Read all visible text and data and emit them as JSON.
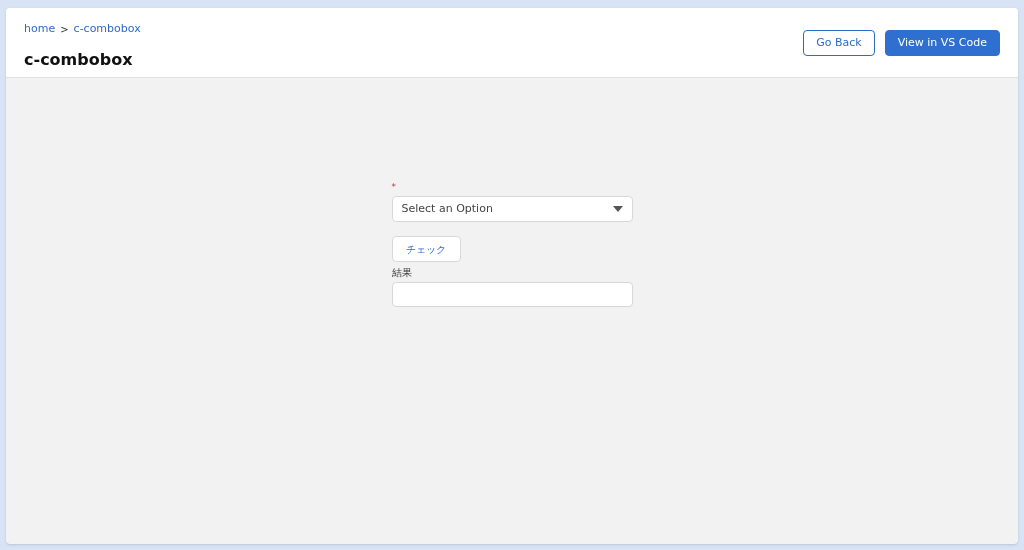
{
  "breadcrumb": [
    {
      "label": "home"
    },
    {
      "label": "c-combobox"
    }
  ],
  "breadcrumb_separator": ">",
  "title": "c-combobox",
  "buttons": [
    {
      "label": "Go Back",
      "kind": "outline"
    },
    {
      "label": "View in VS Code",
      "kind": "brand"
    }
  ],
  "form": {
    "required_mark": "*",
    "combobox": {
      "placeholder": "Select an Option"
    },
    "check_button": "チェック",
    "result": {
      "label": "結果"
    }
  }
}
